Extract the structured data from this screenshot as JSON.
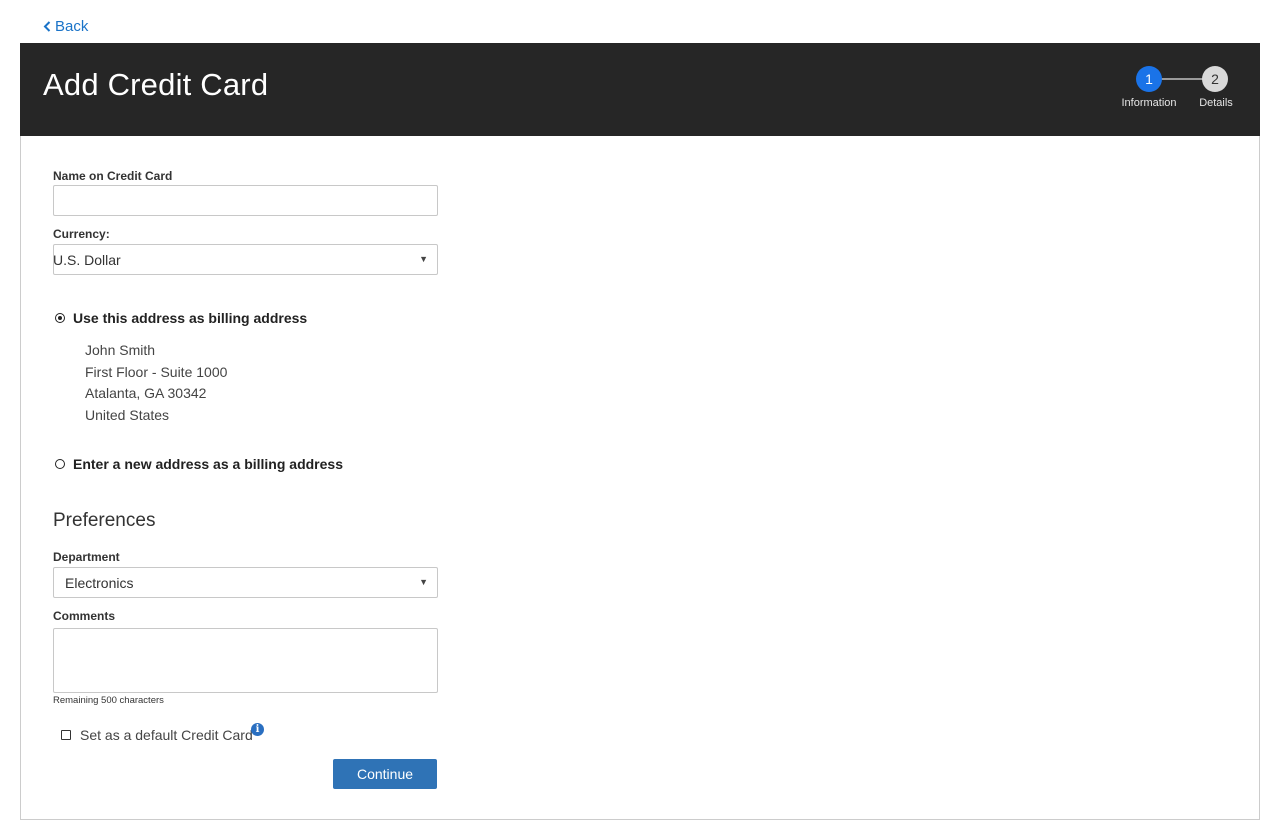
{
  "nav": {
    "back_label": "Back"
  },
  "header": {
    "title": "Add Credit Card"
  },
  "stepper": {
    "steps": [
      {
        "number": "1",
        "label": "Information",
        "active": true
      },
      {
        "number": "2",
        "label": "Details",
        "active": false
      }
    ],
    "active_color": "#1a73e8"
  },
  "form": {
    "name_label": "Name on Credit Card",
    "name_value": "",
    "currency_label": "Currency:",
    "currency_value": "U.S. Dollar",
    "billing_option_existing": "Use this address as billing address",
    "billing_option_new": "Enter a new address as a billing address",
    "billing_selected": "existing",
    "address": {
      "line1": "John Smith",
      "line2": "First Floor - Suite 1000",
      "line3": "Atalanta, GA 30342",
      "line4": "United States"
    },
    "preferences_title": "Preferences",
    "department_label": "Department",
    "department_value": "Electronics",
    "comments_label": "Comments",
    "comments_value": "",
    "remaining_text": "Remaining 500 characters",
    "default_checkbox_label": "Set as a default Credit Card",
    "default_checked": false,
    "continue_label": "Continue"
  },
  "colors": {
    "header_bg": "#262626",
    "primary_button": "#2f73b6",
    "link": "#1a73c8"
  }
}
